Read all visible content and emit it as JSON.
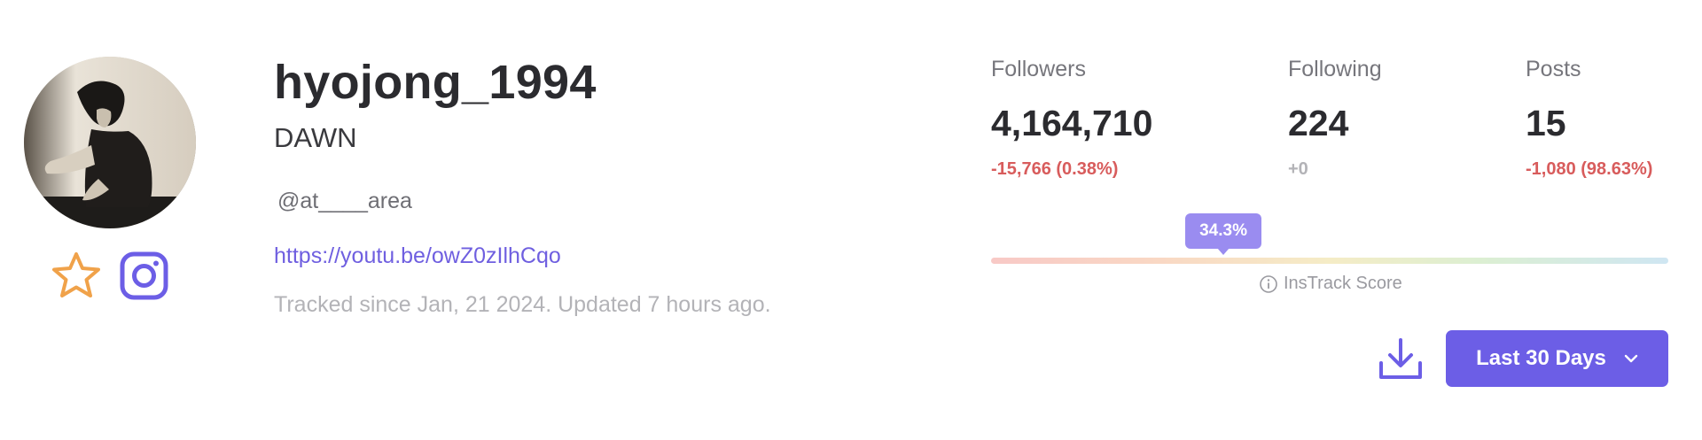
{
  "profile": {
    "username": "hyojong_1994",
    "full_name": "DAWN",
    "bio": "@at____area",
    "link": "https://youtu.be/owZ0zIlhCqo",
    "tracked": "Tracked since Jan, 21 2024. Updated 7 hours ago."
  },
  "icons": {
    "star": "star-icon",
    "instagram": "instagram-icon",
    "info": "info-icon",
    "download": "download-icon",
    "chevron": "chevron-down-icon"
  },
  "stats": {
    "followers": {
      "label": "Followers",
      "value": "4,164,710",
      "change": "-15,766 (0.38%)"
    },
    "following": {
      "label": "Following",
      "value": "224",
      "change": "+0"
    },
    "posts": {
      "label": "Posts",
      "value": "15",
      "change": "-1,080 (98.63%)"
    }
  },
  "score": {
    "value_label": "34.3%",
    "value": 0.343,
    "label": "InsTrack Score"
  },
  "actions": {
    "period_label": "Last 30 Days"
  },
  "colors": {
    "accent": "#6c5ee6",
    "link": "#6f5fe0",
    "star": "#f0a24a",
    "negative": "#d85c5c",
    "tooltip": "#9a8cf0"
  }
}
